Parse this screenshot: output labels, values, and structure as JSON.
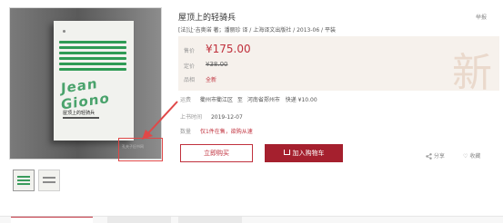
{
  "product": {
    "title": "屋顶上的轻骑兵",
    "publish_info": "[法]让·吉奥诺 著；潘丽珍 译 / 上海译文出版社 / 2013-06 / 平装",
    "report_label": "举报",
    "cover_text": "Jean Giono",
    "cover_subtitle": "屋顶上的轻骑兵"
  },
  "price_panel": {
    "price_label": "售价",
    "price": "¥175.00",
    "original_label": "定价",
    "original_price": "¥38.00",
    "condition_label": "品相",
    "condition": "全新",
    "seal_char": "新"
  },
  "shipping": {
    "label": "运费",
    "from": "衢州市衢江区",
    "to_sep": "至",
    "to": "河南省郑州市",
    "method": "快递 ¥10.00"
  },
  "listed": {
    "label": "上书时间",
    "date": "2019-12-07"
  },
  "quantity": {
    "label": "数量",
    "value": "仅1件在售，欲购从速"
  },
  "actions": {
    "buy_label": "立即购买",
    "cart_label": "加入购物车",
    "share_label": "分享",
    "fav_label": "收藏"
  },
  "watermark": {
    "text": "孔夫子旧书网"
  },
  "colors": {
    "accent": "#c0313d",
    "cart_button": "#a5202e",
    "price_panel_bg": "#f6f1ec",
    "highlight_border": "#e04848"
  },
  "icons": [
    "cart-icon",
    "share-icon",
    "heart-icon",
    "arrow-icon"
  ]
}
